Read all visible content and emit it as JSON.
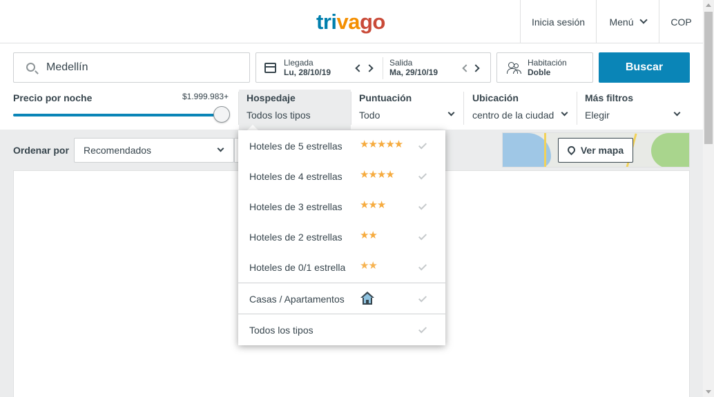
{
  "header": {
    "logo": {
      "t1": "tri",
      "t2": "va",
      "t3": "go",
      "colors": [
        "#007fad",
        "#f48f00",
        "#c94a38"
      ]
    },
    "login": "Inicia sesión",
    "menu": "Menú",
    "currency": "COP"
  },
  "search": {
    "destination": "Medellín",
    "checkin_label": "Llegada",
    "checkin_value": "Lu, 28/10/19",
    "checkout_label": "Salida",
    "checkout_value": "Ma, 29/10/19",
    "room_label": "Habitación",
    "room_value": "Doble",
    "search_button": "Buscar",
    "accent": "#0a85b7"
  },
  "filters": {
    "price_label": "Precio por noche",
    "price_max": "$1.999.983+",
    "price_fill": 1.0,
    "lodging_label": "Hospedaje",
    "lodging_value": "Todos los tipos",
    "rating_label": "Puntuación",
    "rating_value": "Todo",
    "location_label": "Ubicación",
    "location_value": "centro de la ciudad",
    "more_label": "Más filtros",
    "more_value": "Elegir"
  },
  "sort": {
    "label": "Ordenar por",
    "value": "Recomendados"
  },
  "map": {
    "button": "Ver mapa"
  },
  "dropdown": {
    "items": [
      {
        "label": "Hoteles de 5 estrellas",
        "stars": "★★★★★"
      },
      {
        "label": "Hoteles de 4 estrellas",
        "stars": "★★★★"
      },
      {
        "label": "Hoteles de 3 estrellas",
        "stars": "★★★"
      },
      {
        "label": "Hoteles de 2 estrellas",
        "stars": "★★"
      },
      {
        "label": "Hoteles de 0/1 estrella",
        "stars": "★★"
      },
      {
        "label": "Casas / Apartamentos",
        "icon": "house-icon"
      },
      {
        "label": "Todos los tipos"
      }
    ],
    "star_color": "#f6ab3f"
  }
}
